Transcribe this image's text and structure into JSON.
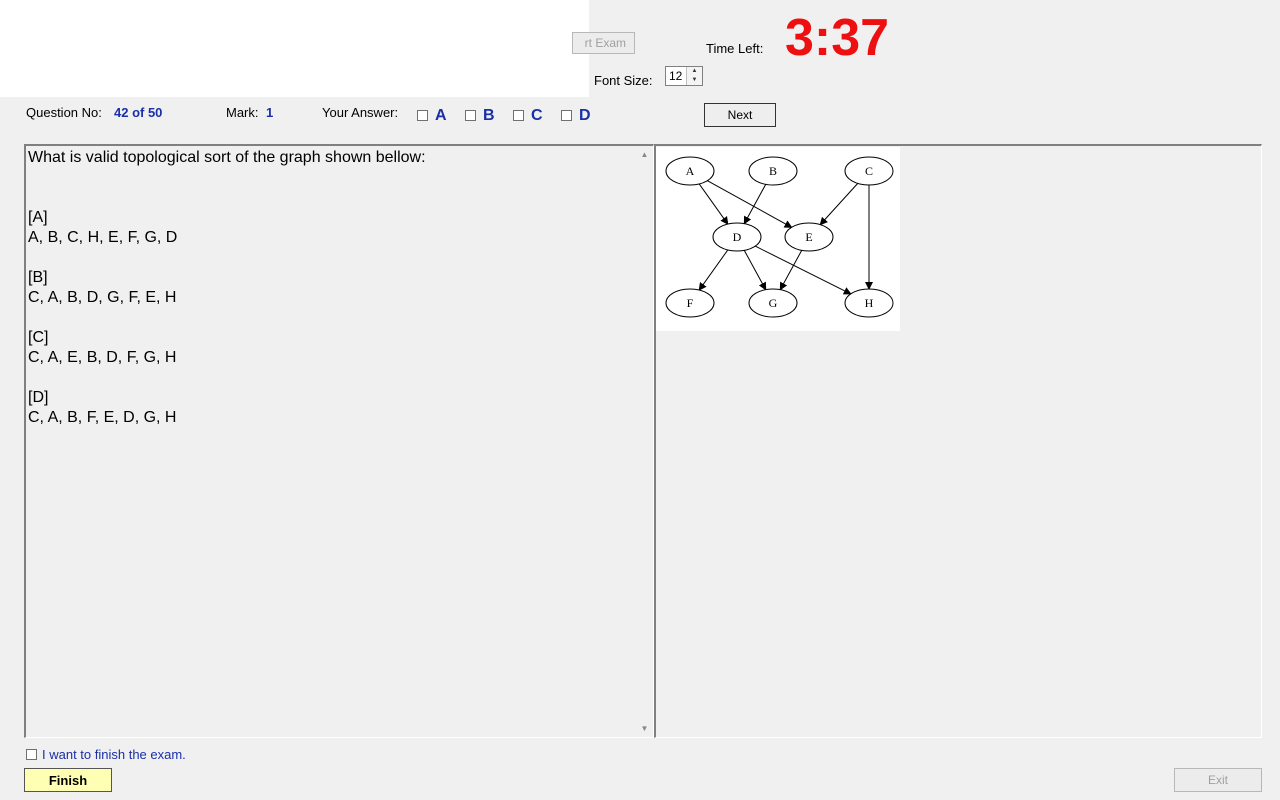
{
  "header": {
    "start_exam_label": "rt Exam",
    "time_left_label": "Time Left:",
    "time_left_value": "3:37",
    "font_size_label": "Font Size:",
    "font_size_value": "12"
  },
  "question_bar": {
    "question_no_label": "Question No:",
    "question_no_value": "42 of 50",
    "mark_label": "Mark:",
    "mark_value": "1",
    "your_answer_label": "Your Answer:",
    "options": [
      "A",
      "B",
      "C",
      "D"
    ],
    "next_label": "Next"
  },
  "question": {
    "text": "What is valid topological sort of the graph shown bellow:\n\n\n[A]\nA, B, C, H, E, F, G, D\n\n[B]\nC, A, B, D, G, F, E, H\n\n[C]\nC, A, E, B, D, F, G, H\n\n[D]\nC, A, B, F, E, D, G, H"
  },
  "graph": {
    "nodes": [
      "A",
      "B",
      "C",
      "D",
      "E",
      "F",
      "G",
      "H"
    ],
    "edges": [
      [
        "A",
        "D"
      ],
      [
        "A",
        "E"
      ],
      [
        "B",
        "D"
      ],
      [
        "C",
        "E"
      ],
      [
        "C",
        "H"
      ],
      [
        "D",
        "F"
      ],
      [
        "D",
        "G"
      ],
      [
        "D",
        "H"
      ],
      [
        "E",
        "G"
      ]
    ]
  },
  "footer": {
    "finish_checkbox_label": "I want to finish the exam.",
    "finish_label": "Finish",
    "exit_label": "Exit"
  }
}
